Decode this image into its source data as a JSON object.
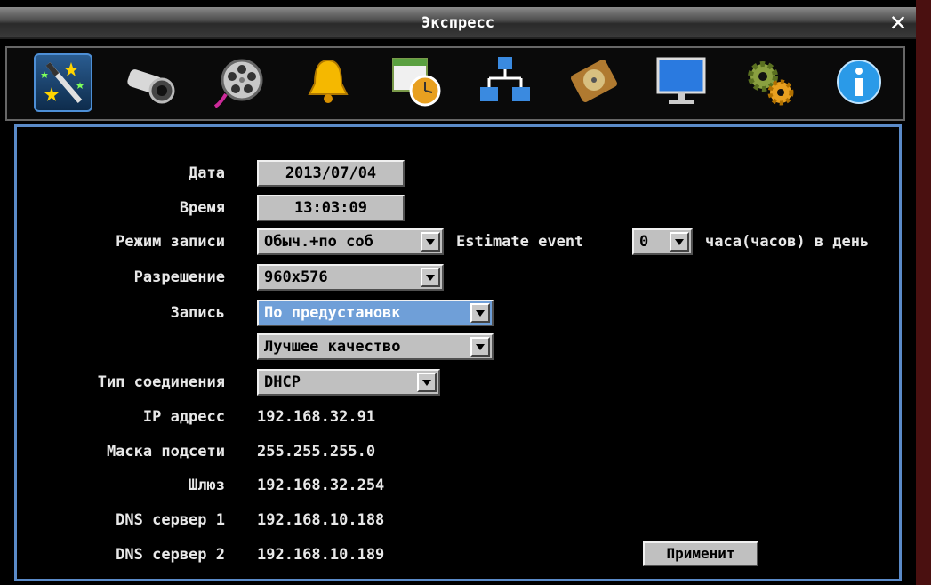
{
  "window": {
    "title": "Экспресс"
  },
  "toolbar": {
    "items": [
      {
        "icon": "wand-icon",
        "active": true
      },
      {
        "icon": "camera-icon"
      },
      {
        "icon": "film-reel-icon"
      },
      {
        "icon": "bell-icon"
      },
      {
        "icon": "schedule-clock-icon"
      },
      {
        "icon": "network-icon"
      },
      {
        "icon": "hard-disk-icon"
      },
      {
        "icon": "monitor-icon"
      },
      {
        "icon": "gears-icon"
      },
      {
        "icon": "info-icon"
      }
    ]
  },
  "form": {
    "date": {
      "label": "Дата",
      "value": "2013/07/04"
    },
    "time": {
      "label": "Время",
      "value": "13:03:09"
    },
    "record_mode": {
      "label": "Режим записи",
      "value": "Обыч.+по соб",
      "estimate_label": "Estimate event",
      "estimate_value": "0",
      "hours_text": "часа(часов) в день"
    },
    "resolution": {
      "label": "Разрешение",
      "value": "960x576"
    },
    "recording": {
      "label": "Запись",
      "preset_value": "По предустановк",
      "quality_value": "Лучшее качество"
    },
    "connection": {
      "label": "Тип соединения",
      "value": "DHCP"
    },
    "ip": {
      "label": "IP адресс",
      "value": "192.168.32.91"
    },
    "mask": {
      "label": "Маска подсети",
      "value": "255.255.255.0"
    },
    "gateway": {
      "label": "Шлюз",
      "value": "192.168.32.254"
    },
    "dns1": {
      "label": "DNS сервер 1",
      "value": "192.168.10.188"
    },
    "dns2": {
      "label": "DNS сервер 2",
      "value": "192.168.10.189"
    },
    "apply_label": "Применит"
  },
  "colors": {
    "panel_border": "#5a8ac8",
    "highlight": "#6f9fd8",
    "field_bg": "#c0c0c0"
  }
}
